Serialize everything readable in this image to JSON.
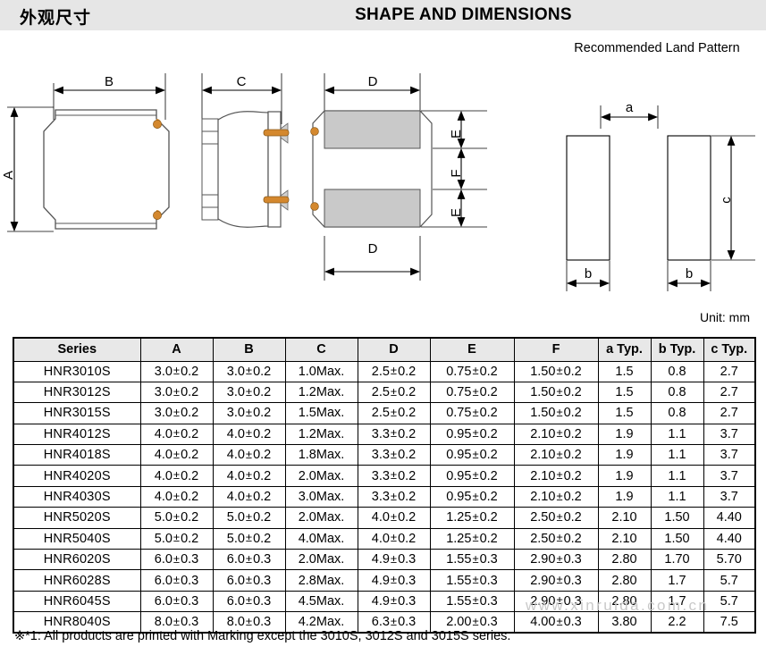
{
  "header": {
    "title_cn": "外观尺寸",
    "title_en": "SHAPE AND DIMENSIONS",
    "land_pattern_title": "Recommended Land Pattern"
  },
  "drawings": {
    "top_view": {
      "label_a": "A",
      "label_b": "B"
    },
    "side_view": {
      "label_c": "C"
    },
    "bottom_view": {
      "label_d_top": "D",
      "label_d_bottom": "D",
      "label_e_top": "E",
      "label_f": "F",
      "label_e_bottom": "E"
    },
    "land_pattern": {
      "label_a": "a",
      "label_b_left": "b",
      "label_b_right": "b",
      "label_c": "c"
    }
  },
  "unit_label": "Unit: mm",
  "table": {
    "columns": [
      "Series",
      "A",
      "B",
      "C",
      "D",
      "E",
      "F",
      "a Typ.",
      "b Typ.",
      "c Typ."
    ],
    "rows": [
      {
        "series": "HNR3010S",
        "a": "3.0±0.2",
        "b": "3.0±0.2",
        "c": "1.0Max.",
        "d": "2.5±0.2",
        "e": "0.75±0.2",
        "f": "1.50±0.2",
        "a_typ": "1.5",
        "b_typ": "0.8",
        "c_typ": "2.7"
      },
      {
        "series": "HNR3012S",
        "a": "3.0±0.2",
        "b": "3.0±0.2",
        "c": "1.2Max.",
        "d": "2.5±0.2",
        "e": "0.75±0.2",
        "f": "1.50±0.2",
        "a_typ": "1.5",
        "b_typ": "0.8",
        "c_typ": "2.7"
      },
      {
        "series": "HNR3015S",
        "a": "3.0±0.2",
        "b": "3.0±0.2",
        "c": "1.5Max.",
        "d": "2.5±0.2",
        "e": "0.75±0.2",
        "f": "1.50±0.2",
        "a_typ": "1.5",
        "b_typ": "0.8",
        "c_typ": "2.7"
      },
      {
        "series": "HNR4012S",
        "a": "4.0±0.2",
        "b": "4.0±0.2",
        "c": "1.2Max.",
        "d": "3.3±0.2",
        "e": "0.95±0.2",
        "f": "2.10±0.2",
        "a_typ": "1.9",
        "b_typ": "1.1",
        "c_typ": "3.7"
      },
      {
        "series": "HNR4018S",
        "a": "4.0±0.2",
        "b": "4.0±0.2",
        "c": "1.8Max.",
        "d": "3.3±0.2",
        "e": "0.95±0.2",
        "f": "2.10±0.2",
        "a_typ": "1.9",
        "b_typ": "1.1",
        "c_typ": "3.7"
      },
      {
        "series": "HNR4020S",
        "a": "4.0±0.2",
        "b": "4.0±0.2",
        "c": "2.0Max.",
        "d": "3.3±0.2",
        "e": "0.95±0.2",
        "f": "2.10±0.2",
        "a_typ": "1.9",
        "b_typ": "1.1",
        "c_typ": "3.7"
      },
      {
        "series": "HNR4030S",
        "a": "4.0±0.2",
        "b": "4.0±0.2",
        "c": "3.0Max.",
        "d": "3.3±0.2",
        "e": "0.95±0.2",
        "f": "2.10±0.2",
        "a_typ": "1.9",
        "b_typ": "1.1",
        "c_typ": "3.7"
      },
      {
        "series": "HNR5020S",
        "a": "5.0±0.2",
        "b": "5.0±0.2",
        "c": "2.0Max.",
        "d": "4.0±0.2",
        "e": "1.25±0.2",
        "f": "2.50±0.2",
        "a_typ": "2.10",
        "b_typ": "1.50",
        "c_typ": "4.40"
      },
      {
        "series": "HNR5040S",
        "a": "5.0±0.2",
        "b": "5.0±0.2",
        "c": "4.0Max.",
        "d": "4.0±0.2",
        "e": "1.25±0.2",
        "f": "2.50±0.2",
        "a_typ": "2.10",
        "b_typ": "1.50",
        "c_typ": "4.40"
      },
      {
        "series": "HNR6020S",
        "a": "6.0±0.3",
        "b": "6.0±0.3",
        "c": "2.0Max.",
        "d": "4.9±0.3",
        "e": "1.55±0.3",
        "f": "2.90±0.3",
        "a_typ": "2.80",
        "b_typ": "1.70",
        "c_typ": "5.70"
      },
      {
        "series": "HNR6028S",
        "a": "6.0±0.3",
        "b": "6.0±0.3",
        "c": "2.8Max.",
        "d": "4.9±0.3",
        "e": "1.55±0.3",
        "f": "2.90±0.3",
        "a_typ": "2.80",
        "b_typ": "1.7",
        "c_typ": "5.7"
      },
      {
        "series": "HNR6045S",
        "a": "6.0±0.3",
        "b": "6.0±0.3",
        "c": "4.5Max.",
        "d": "4.9±0.3",
        "e": "1.55±0.3",
        "f": "2.90±0.3",
        "a_typ": "2.80",
        "b_typ": "1.7",
        "c_typ": "5.7"
      },
      {
        "series": "HNR8040S",
        "a": "8.0±0.3",
        "b": "8.0±0.3",
        "c": "4.2Max.",
        "d": "6.3±0.3",
        "e": "2.00±0.3",
        "f": "4.00±0.3",
        "a_typ": "3.80",
        "b_typ": "2.2",
        "c_typ": "7.5"
      }
    ]
  },
  "footnote": "※*1: All products are printed with Marking except the 3010S, 3012S and 3015S series.",
  "watermark": "www.xinruida.com.cn",
  "colors": {
    "banner_bg": "#e6e6e6",
    "header_row_bg": "#e8e8e8",
    "terminal_orange": "#d4882e",
    "pad_gray": "#c9c9c9",
    "line": "#000000",
    "watermark_gray": "#c9c9c9"
  }
}
